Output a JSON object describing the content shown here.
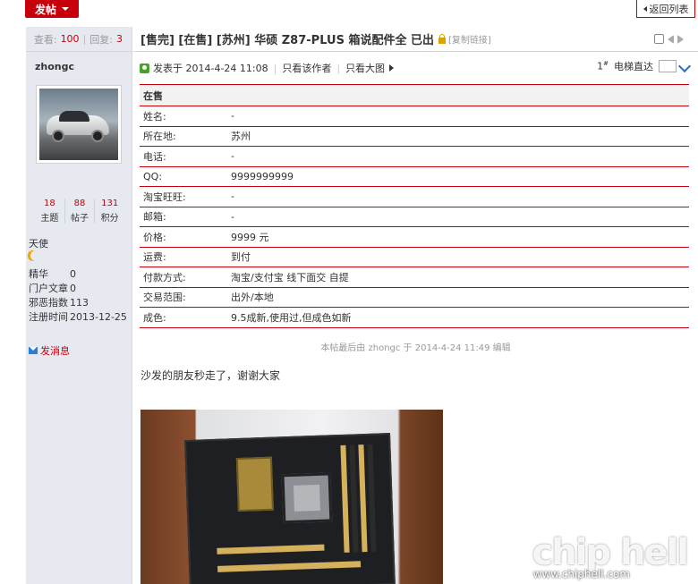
{
  "toolbar": {
    "post_label": "发帖",
    "back_label": "返回列表"
  },
  "sidebar": {
    "views_label": "查看:",
    "views_value": "100",
    "replies_label": "回复:",
    "replies_value": "3",
    "username": "zhongc",
    "counts": [
      {
        "value": "18",
        "label": "主题"
      },
      {
        "value": "88",
        "label": "帖子"
      },
      {
        "value": "131",
        "label": "积分"
      }
    ],
    "rank": "天使",
    "info": [
      {
        "key": "精华",
        "value": "0"
      },
      {
        "key": "门户文章",
        "value": "0"
      },
      {
        "key": "邪恶指数",
        "value": "113"
      },
      {
        "key": "注册时间",
        "value": "2013-12-25"
      }
    ],
    "message_label": "发消息"
  },
  "post": {
    "title": "[售完] [在售] [苏州] 华硕 Z87-PLUS 箱说配件全 已出",
    "copy_link": "[复制链接]",
    "posted_at": "发表于 2014-4-24 11:08",
    "only_author": "只看该作者",
    "large_image": "只看大图",
    "floor": "1",
    "floor_suffix": "#",
    "jump_label": "电梯直达",
    "table_header": "在售",
    "rows": [
      {
        "k": "姓名:",
        "v": "-"
      },
      {
        "k": "所在地:",
        "v": "苏州"
      },
      {
        "k": "电话:",
        "v": "-"
      },
      {
        "k": "QQ:",
        "v": "9999999999"
      },
      {
        "k": "淘宝旺旺:",
        "v": "-"
      },
      {
        "k": "邮箱:",
        "v": "-"
      },
      {
        "k": "价格:",
        "v": "9999 元"
      },
      {
        "k": "运费:",
        "v": "到付"
      },
      {
        "k": "付款方式:",
        "v": "淘宝/支付宝 线下面交 自提"
      },
      {
        "k": "交易范围:",
        "v": "出外/本地"
      },
      {
        "k": "成色:",
        "v": "9.5成新,使用过,但成色如新"
      }
    ],
    "edit_note": "本帖最后由 zhongc 于 2014-4-24 11:49 编辑",
    "content": "沙发的朋友秒走了，谢谢大家"
  },
  "watermark": {
    "logo": "chip hell",
    "url": "www.chiphell.com"
  }
}
